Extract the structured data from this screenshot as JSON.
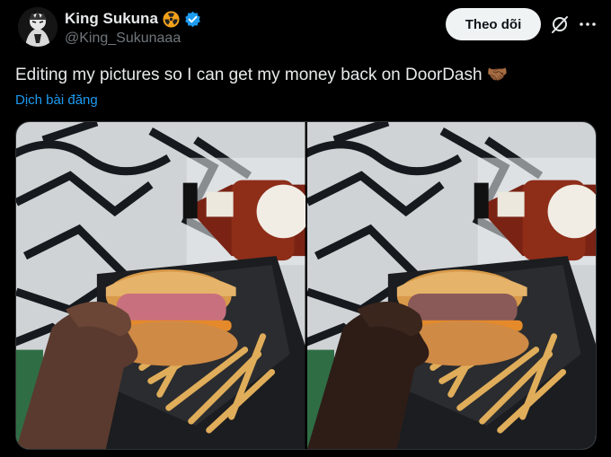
{
  "author": {
    "display_name": "King Sukuna",
    "handle": "@King_Sukunaaa",
    "badge_icon": "radioactive-icon",
    "verified_icon": "verified-badge-icon"
  },
  "actions": {
    "follow_label": "Theo dõi",
    "grok_icon": "grok-icon",
    "more_icon": "more-icon"
  },
  "tweet": {
    "text": "Editing my pictures so I can get my money back on DoorDash 🤝🏾",
    "translate_label": "Dịch bài đăng"
  },
  "media": {
    "images": [
      {
        "patty_color": "#c9707e"
      },
      {
        "patty_color": "#8a5a58"
      }
    ]
  },
  "colors": {
    "background": "#000000",
    "text": "#e7e9ea",
    "muted": "#71767b",
    "link": "#1d9bf0",
    "verified": "#1d9bf0"
  }
}
